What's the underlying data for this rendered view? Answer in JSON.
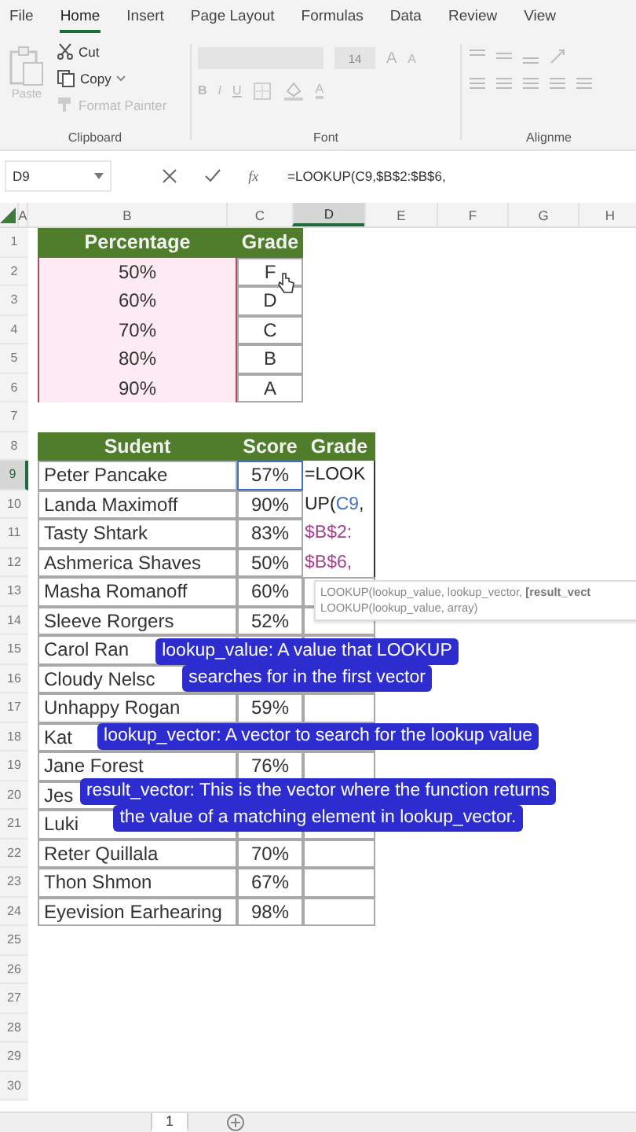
{
  "ribbon": {
    "tabs": [
      {
        "label": "File",
        "selected": false
      },
      {
        "label": "Home",
        "selected": true
      },
      {
        "label": "Insert",
        "selected": false
      },
      {
        "label": "Page Layout",
        "selected": false
      },
      {
        "label": "Formulas",
        "selected": false
      },
      {
        "label": "Data",
        "selected": false
      },
      {
        "label": "Review",
        "selected": false
      },
      {
        "label": "View",
        "selected": false
      }
    ],
    "clipboard": {
      "label": "Clipboard",
      "paste": {
        "label": "Paste",
        "disabled": true
      },
      "cut": {
        "label": "Cut",
        "disabled": false
      },
      "copy": {
        "label": "Copy",
        "disabled": false
      },
      "format_painter": {
        "label": "Format Painter",
        "disabled": true
      }
    },
    "font": {
      "label": "Font",
      "size": "14",
      "grow": "A",
      "shrink": "A",
      "bold": "B",
      "italic": "I",
      "underline": "U",
      "font_color": "A"
    },
    "alignment": {
      "label": "Alignme"
    }
  },
  "formula_bar": {
    "name_box": "D9",
    "fx": "fx",
    "formula": "=LOOKUP(C9,$B$2:$B$6,"
  },
  "columns": [
    {
      "label": "A",
      "selected": false
    },
    {
      "label": "B",
      "selected": false
    },
    {
      "label": "C",
      "selected": false
    },
    {
      "label": "D",
      "selected": true
    },
    {
      "label": "E",
      "selected": false
    },
    {
      "label": "F",
      "selected": false
    },
    {
      "label": "G",
      "selected": false
    },
    {
      "label": "H",
      "selected": false
    }
  ],
  "row_numbers": [
    {
      "label": "1",
      "selected": false
    },
    {
      "label": "2",
      "selected": false
    },
    {
      "label": "3",
      "selected": false
    },
    {
      "label": "4",
      "selected": false
    },
    {
      "label": "5",
      "selected": false
    },
    {
      "label": "6",
      "selected": false
    },
    {
      "label": "7",
      "selected": false
    },
    {
      "label": "8",
      "selected": false
    },
    {
      "label": "9",
      "selected": true
    },
    {
      "label": "10",
      "selected": false
    },
    {
      "label": "11",
      "selected": false
    },
    {
      "label": "12",
      "selected": false
    },
    {
      "label": "13",
      "selected": false
    },
    {
      "label": "14",
      "selected": false
    },
    {
      "label": "15",
      "selected": false
    },
    {
      "label": "16",
      "selected": false
    },
    {
      "label": "17",
      "selected": false
    },
    {
      "label": "18",
      "selected": false
    },
    {
      "label": "19",
      "selected": false
    },
    {
      "label": "20",
      "selected": false
    },
    {
      "label": "21",
      "selected": false
    },
    {
      "label": "22",
      "selected": false
    },
    {
      "label": "23",
      "selected": false
    },
    {
      "label": "24",
      "selected": false
    },
    {
      "label": "25",
      "selected": false
    },
    {
      "label": "26",
      "selected": false
    },
    {
      "label": "27",
      "selected": false
    },
    {
      "label": "28",
      "selected": false
    },
    {
      "label": "29",
      "selected": false
    },
    {
      "label": "30",
      "selected": false
    }
  ],
  "grade_table": {
    "headers": [
      "Percentage",
      "Grade"
    ],
    "rows": [
      {
        "percentage": "50%",
        "grade": "F",
        "selected": true
      },
      {
        "percentage": "60%",
        "grade": "D",
        "selected": true
      },
      {
        "percentage": "70%",
        "grade": "C",
        "selected": true
      },
      {
        "percentage": "80%",
        "grade": "B",
        "selected": true
      },
      {
        "percentage": "90%",
        "grade": "A",
        "selected": true
      }
    ]
  },
  "student_table": {
    "headers": [
      "Sudent",
      "Score",
      "Grade"
    ],
    "rows": [
      {
        "name": "Peter Pancake",
        "score": "57%",
        "score_selected": true
      },
      {
        "name": "Landa Maximoff",
        "score": "90%",
        "score_selected": false
      },
      {
        "name": "Tasty Shtark",
        "score": "83%",
        "score_selected": false
      },
      {
        "name": "Ashmerica Shaves",
        "score": "50%",
        "score_selected": false
      },
      {
        "name": "Masha Romanoff",
        "score": "60%",
        "score_selected": false
      },
      {
        "name": "Sleeve Rorgers",
        "score": "52%",
        "score_selected": false
      },
      {
        "name": "Carol Ran"
      },
      {
        "name": "Cloudy Nelsc"
      },
      {
        "name": "Unhappy Rogan",
        "score": "59%",
        "score_selected": false
      },
      {
        "name": "Kat"
      },
      {
        "name": "Jane Forest",
        "score": "76%",
        "score_selected": false
      },
      {
        "name": "Jes"
      },
      {
        "name": "Luki"
      },
      {
        "name": "Reter Quillala",
        "score": "70%",
        "score_selected": false
      },
      {
        "name": "Thon Shmon",
        "score": "67%",
        "score_selected": false
      },
      {
        "name": "Eyevision Earhearing",
        "score": "98%",
        "score_selected": false
      }
    ]
  },
  "cell_edit": {
    "lines": [
      [
        {
          "text": "=LOOK",
          "kind": "plain"
        }
      ],
      [
        {
          "text": "UP(",
          "kind": "plain"
        },
        {
          "text": "C9",
          "kind": "ref1"
        },
        {
          "text": ",",
          "kind": "plain"
        }
      ],
      [
        {
          "text": "$B$2:",
          "kind": "ref2"
        }
      ],
      [
        {
          "text": "$B$6,",
          "kind": "ref2"
        }
      ]
    ]
  },
  "tooltip": {
    "lines": [
      "LOOKUP(lookup_value, lookup_vector, **[result_vect**",
      "LOOKUP(lookup_value, array)"
    ]
  },
  "captions": [
    {
      "lines": [
        "lookup_value: A value that LOOKUP",
        "searches for in the first vector"
      ]
    },
    {
      "lines": [
        "lookup_vector: A vector to search for the lookup value"
      ]
    },
    {
      "lines": [
        "result_vector: This is the vector where the function returns",
        "the value of a matching element in lookup_vector."
      ]
    }
  ],
  "sheet_tabs": [
    {
      "label": "1",
      "selected": true
    }
  ]
}
